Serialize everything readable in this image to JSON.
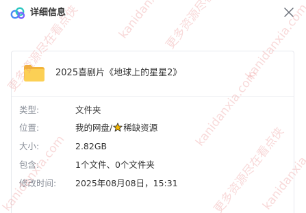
{
  "dialog": {
    "title": "详细信息",
    "icons": {
      "header": "cloud-icon",
      "close": "close-icon",
      "folder": "folder-icon",
      "star": "star-icon"
    }
  },
  "file": {
    "name": "2025喜剧片《地球上的星星2》"
  },
  "details": {
    "type": {
      "label": "类型:",
      "value": "文件夹"
    },
    "location": {
      "label": "位置:",
      "value_prefix": "我的网盘/",
      "value_suffix": "稀缺资源"
    },
    "size": {
      "label": "大小:",
      "value": "2.82GB"
    },
    "contains": {
      "label": "包含:",
      "value": "1个文件、0个文件夹"
    },
    "modified": {
      "label": "修改时间:",
      "value": "2025年08月08日，15:31"
    }
  },
  "watermarks": [
    "kanidanxia.com",
    "更多资源尽在看点侠"
  ],
  "colors": {
    "label": "#8a8f99",
    "text": "#333333",
    "folder": "#f8c94b",
    "watermark": "#e67878",
    "star": "#f5b800"
  }
}
